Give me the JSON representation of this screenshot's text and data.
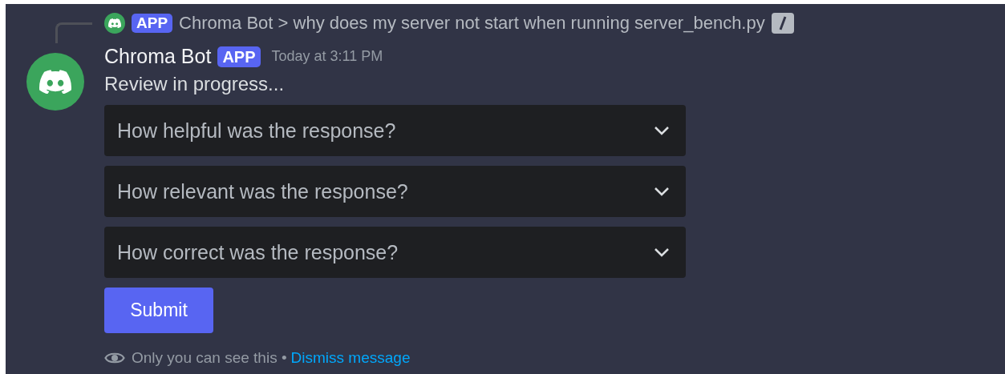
{
  "reply": {
    "badge": "APP",
    "text": "Chroma Bot > why does my server not start when running server_bench.py"
  },
  "message": {
    "author": "Chroma Bot",
    "badge": "APP",
    "time": "Today at 3:11 PM",
    "content": "Review in progress..."
  },
  "selects": [
    {
      "placeholder": "How helpful was the response?"
    },
    {
      "placeholder": "How relevant was the response?"
    },
    {
      "placeholder": "How correct was the response?"
    }
  ],
  "submit": "Submit",
  "footer": {
    "note": "Only you can see this •",
    "link": "Dismiss message"
  }
}
